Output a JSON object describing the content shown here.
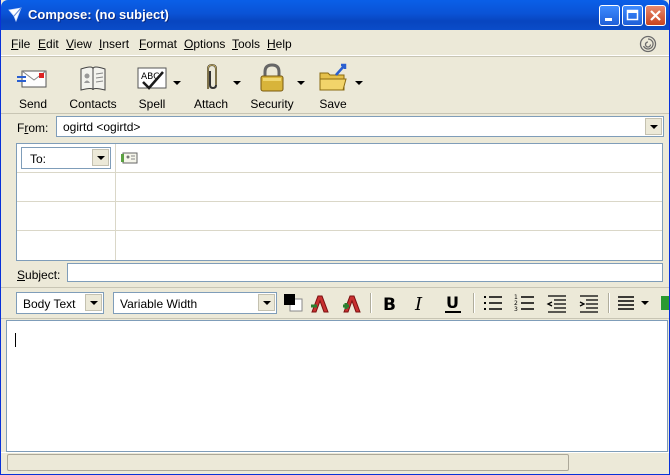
{
  "window": {
    "title": "Compose: (no subject)"
  },
  "menu": [
    {
      "key": "F",
      "rest": "ile"
    },
    {
      "key": "E",
      "rest": "dit"
    },
    {
      "key": "V",
      "rest": "iew"
    },
    {
      "key": "I",
      "rest": "nsert"
    },
    {
      "key": "F",
      "rest": "ormat",
      "pre": ""
    },
    {
      "key": "O",
      "rest": "ptions"
    },
    {
      "key": "T",
      "rest": "ools"
    },
    {
      "key": "H",
      "rest": "elp"
    }
  ],
  "toolbar": {
    "send": "Send",
    "contacts": "Contacts",
    "spell": "Spell",
    "attach": "Attach",
    "security": "Security",
    "save": "Save"
  },
  "from": {
    "label_key": "r",
    "label_pre": "F",
    "label_post": "om:",
    "value": "ogirtd <ogirtd>"
  },
  "to": {
    "type": "To:"
  },
  "subject": {
    "label_key": "S",
    "label_rest": "ubject:",
    "value": ""
  },
  "format": {
    "paragraph_style": "Body Text",
    "font": "Variable Width"
  },
  "body": {
    "text": ""
  },
  "status": {
    "text": ""
  }
}
